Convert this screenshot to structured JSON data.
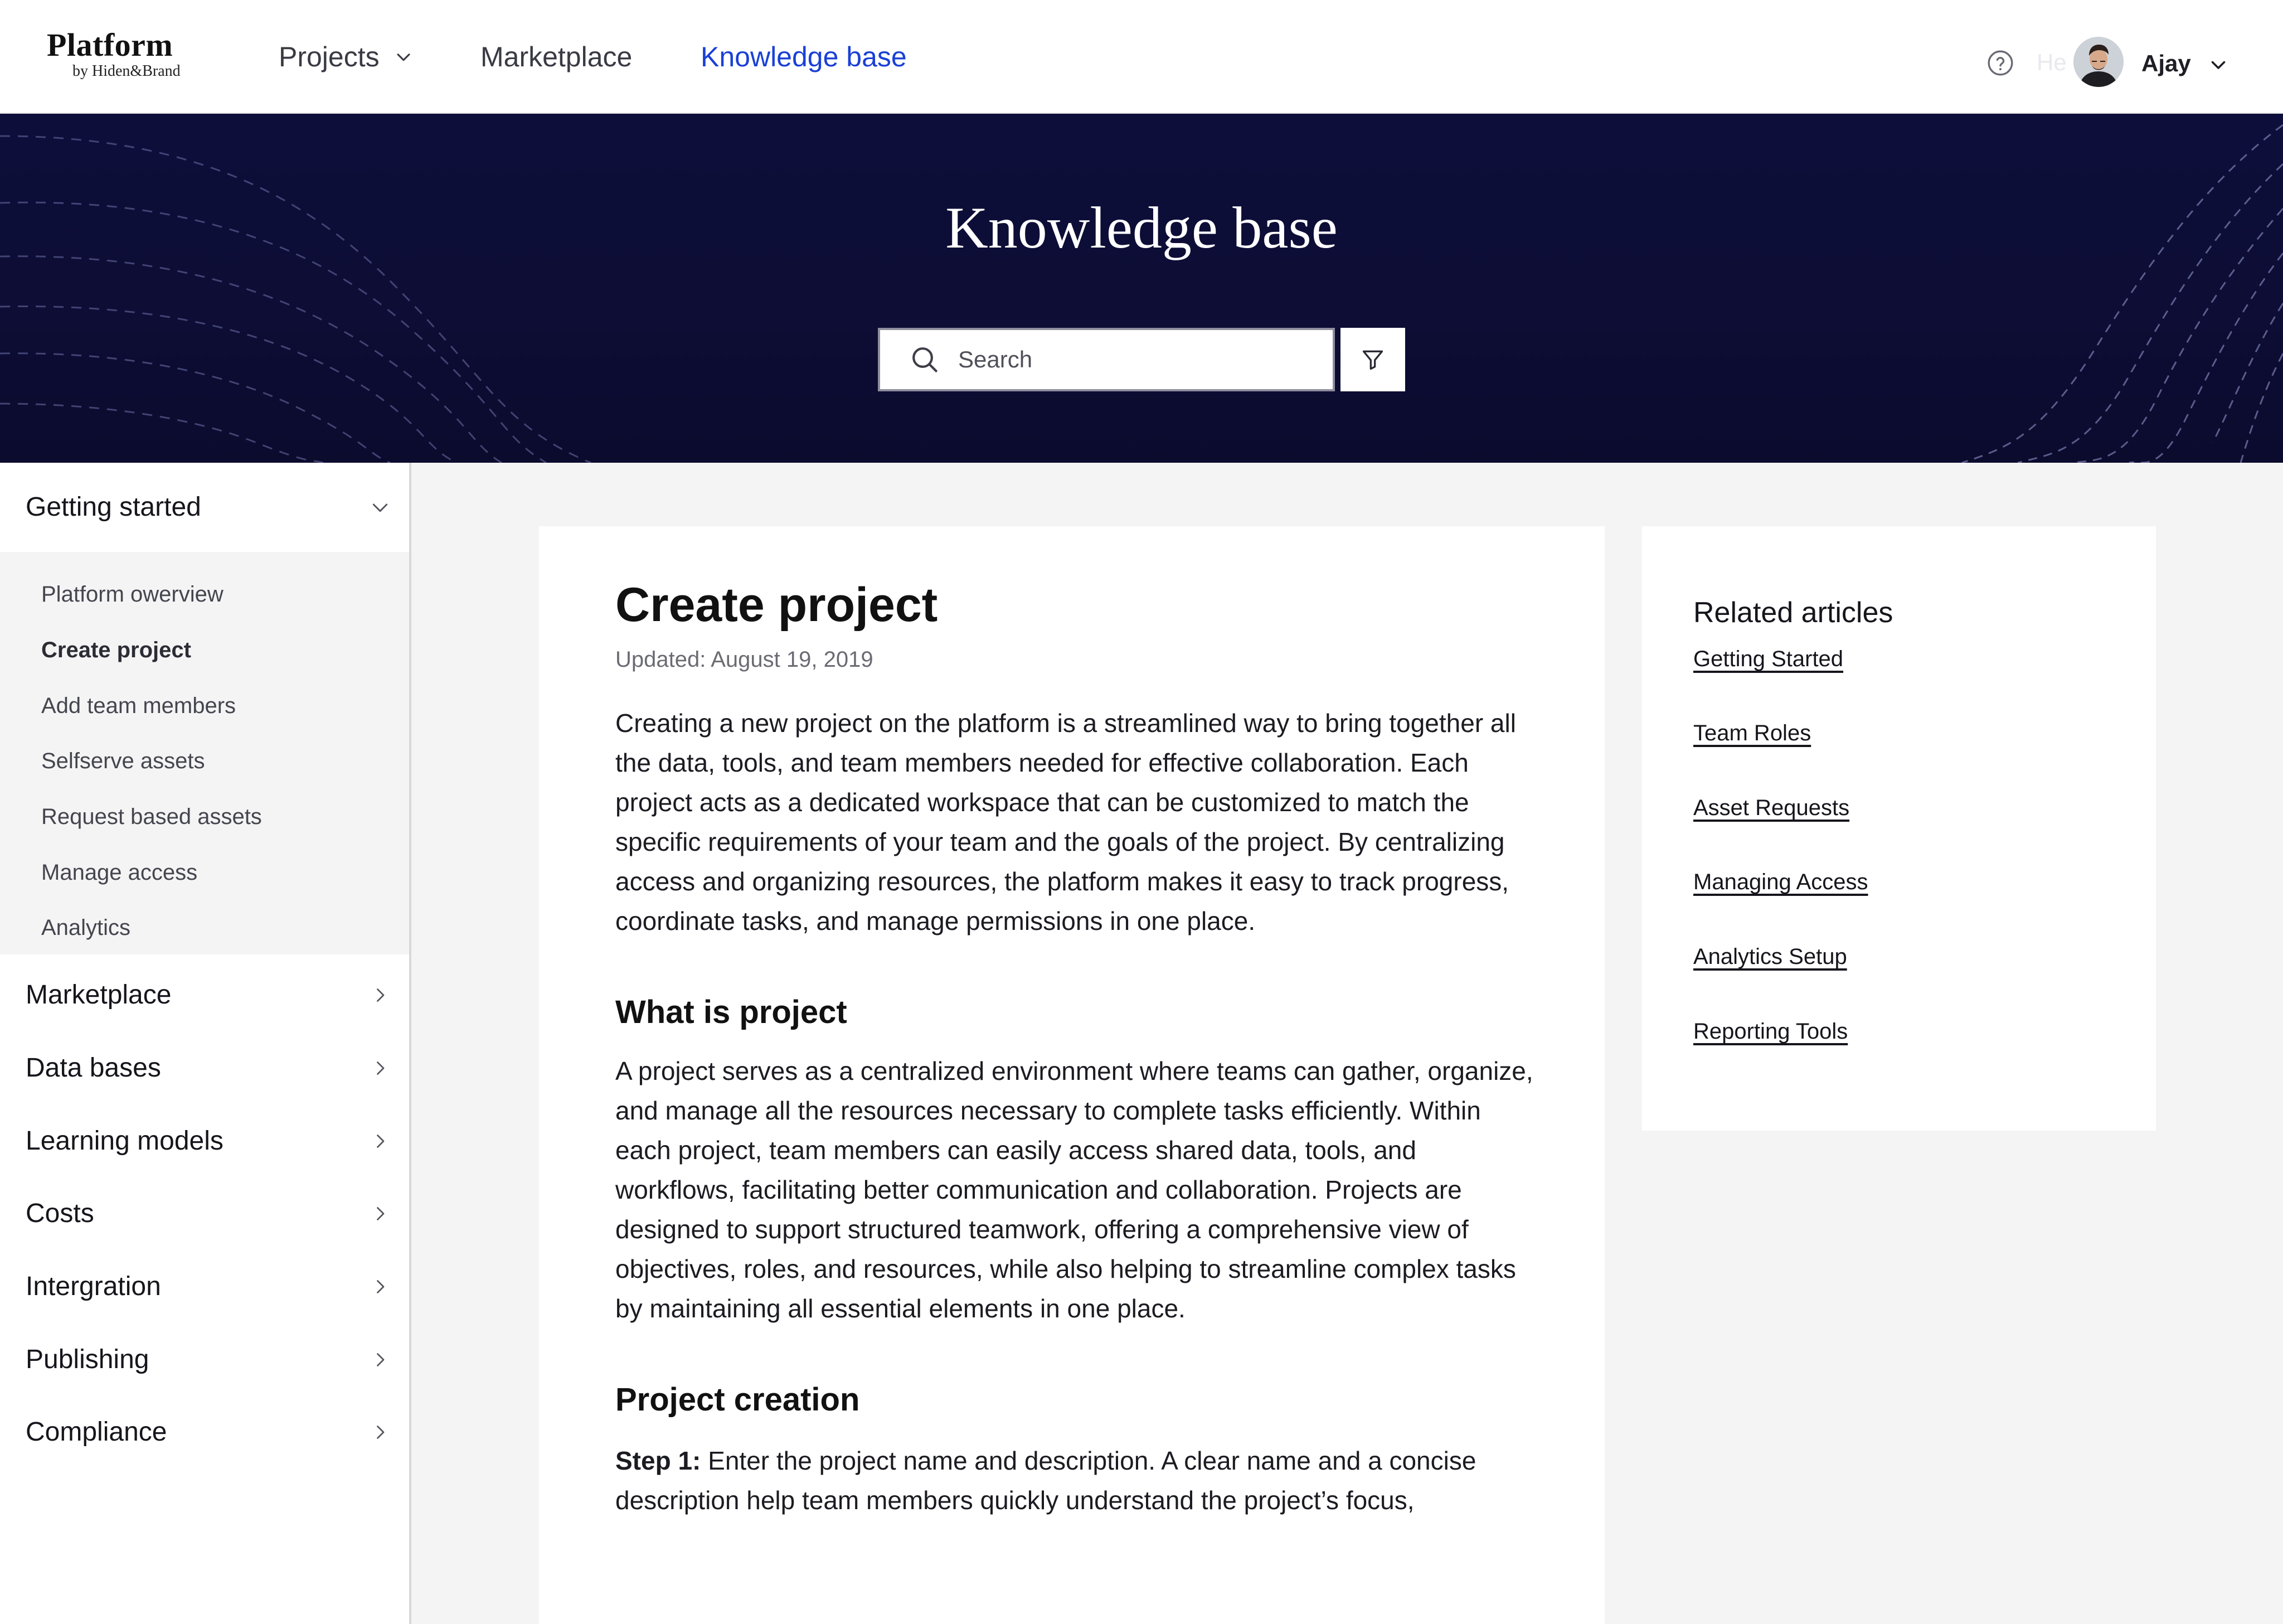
{
  "brand": {
    "name": "Platform",
    "byline": "by Hiden&Brand"
  },
  "nav": {
    "items": [
      {
        "label": "Projects",
        "has_dropdown": true,
        "active": false
      },
      {
        "label": "Marketplace",
        "has_dropdown": false,
        "active": false
      },
      {
        "label": "Knowledge base",
        "has_dropdown": false,
        "active": true
      }
    ]
  },
  "user": {
    "ghost_text": "He",
    "name": "Ajay",
    "icons": [
      "help-icon",
      "avatar",
      "chevron-down-icon"
    ]
  },
  "hero": {
    "title": "Knowledge base",
    "search_placeholder": "Search",
    "icons": [
      "search-icon",
      "filter-icon"
    ]
  },
  "sidebar": {
    "expanded_group": {
      "label": "Getting started",
      "items": [
        {
          "label": "Platform owerview",
          "current": false
        },
        {
          "label": "Create project",
          "current": true
        },
        {
          "label": "Add team members",
          "current": false
        },
        {
          "label": "Selfserve assets",
          "current": false
        },
        {
          "label": "Request based assets",
          "current": false
        },
        {
          "label": "Manage access",
          "current": false
        },
        {
          "label": "Analytics",
          "current": false
        }
      ]
    },
    "groups": [
      {
        "label": "Marketplace"
      },
      {
        "label": "Data bases"
      },
      {
        "label": "Learning models"
      },
      {
        "label": "Costs"
      },
      {
        "label": "Intergration"
      },
      {
        "label": "Publishing"
      },
      {
        "label": "Compliance"
      }
    ]
  },
  "article": {
    "title": "Create project",
    "updated": "Updated: August 19, 2019",
    "intro": "Creating a new project on the platform is a streamlined way to bring together all the data, tools, and team members needed for effective collaboration. Each project acts as a dedicated workspace that can be customized to match the specific requirements of your team and the goals of the project. By centralizing access and organizing resources, the platform makes it easy to track progress, coordinate tasks, and manage permissions in one place.",
    "section1_heading": "What is project",
    "section1_body": "A project serves as a centralized environment where teams can gather, organize, and manage all the resources necessary to complete tasks efficiently. Within each project, team members can easily access shared data, tools, and workflows, facilitating better communication and collaboration. Projects are designed to support structured teamwork, offering a comprehensive view of objectives, roles, and resources, while also helping to streamline complex tasks by maintaining all essential elements in one place.",
    "section2_heading": "Project creation",
    "step1_label": "Step 1:",
    "step1_text": " Enter the project name and description. A clear name and a concise description help team members quickly understand the project’s focus,"
  },
  "related": {
    "title": "Related articles",
    "links": [
      "Getting Started",
      "Team Roles",
      "Asset Requests",
      "Managing Access",
      "Analytics Setup",
      "Reporting Tools"
    ]
  },
  "colors": {
    "accent": "#1a40d6",
    "hero_background": "#0d0e3a",
    "page_background": "#f4f4f4",
    "text": "#16161d"
  }
}
